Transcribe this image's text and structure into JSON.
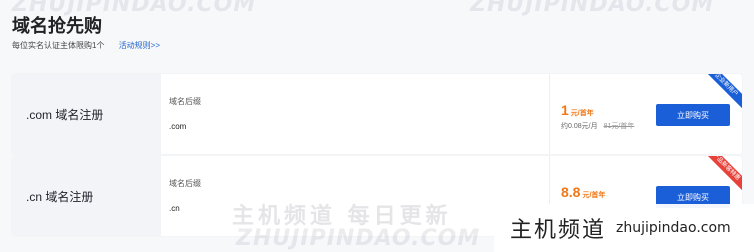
{
  "watermarks": {
    "top_left": "ZHUJIPINDAO.COM",
    "top_right": "ZHUJIPINDAO.COM",
    "bottom": "ZHUJIPINDAO.COM",
    "bottom_cn": "主机频道 每日更新"
  },
  "header": {
    "title": "域名抢先购",
    "note": "每位实名认证主体限购1个",
    "rules_link": "活动规则>>"
  },
  "products": [
    {
      "name": ".com 域名注册",
      "suffix_label": "域名后缀",
      "suffix_value": ".com",
      "price": "1",
      "price_unit": "元/首年",
      "price_sub": "约0.08元/月",
      "original_price": "81元/首年",
      "buy_label": "立即购买",
      "ribbon": "企业新用户",
      "ribbon_color": "#1a5ed8"
    },
    {
      "name": ".cn 域名注册",
      "suffix_label": "域名后缀",
      "suffix_value": ".cn",
      "price": "8.8",
      "price_unit": "元/首年",
      "buy_label": "立即购买",
      "ribbon": "产品新客特惠",
      "ribbon_color": "#e8413a"
    }
  ],
  "brand": {
    "name_cn": "主机频道",
    "domain": "zhujipindao.com"
  }
}
